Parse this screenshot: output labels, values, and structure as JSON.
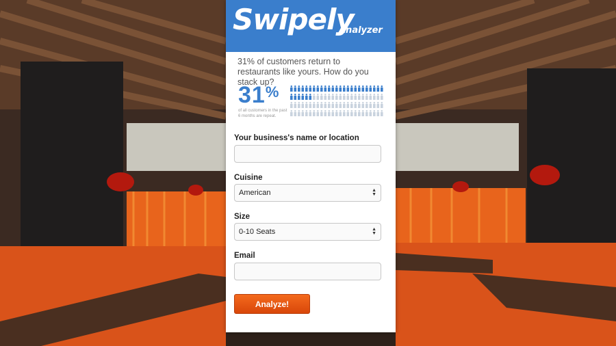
{
  "brand": {
    "logo": "Swipely",
    "logo_sub": "Analyzer",
    "accent": "#3a7ecc"
  },
  "intro": {
    "tagline": "31% of customers return to restaurants like yours. How do you stack up?"
  },
  "stat": {
    "value": "31",
    "sign": "%",
    "note": "of all customers in the past 6 months are repeat.",
    "repeat_fraction": 0.31
  },
  "form": {
    "business": {
      "label": "Your business's name or location",
      "value": ""
    },
    "cuisine": {
      "label": "Cuisine",
      "value": "American"
    },
    "size": {
      "label": "Size",
      "value": "0-10 Seats"
    },
    "email": {
      "label": "Email",
      "value": ""
    },
    "submit_label": "Analyze!",
    "submit_color": "#e5540f"
  }
}
